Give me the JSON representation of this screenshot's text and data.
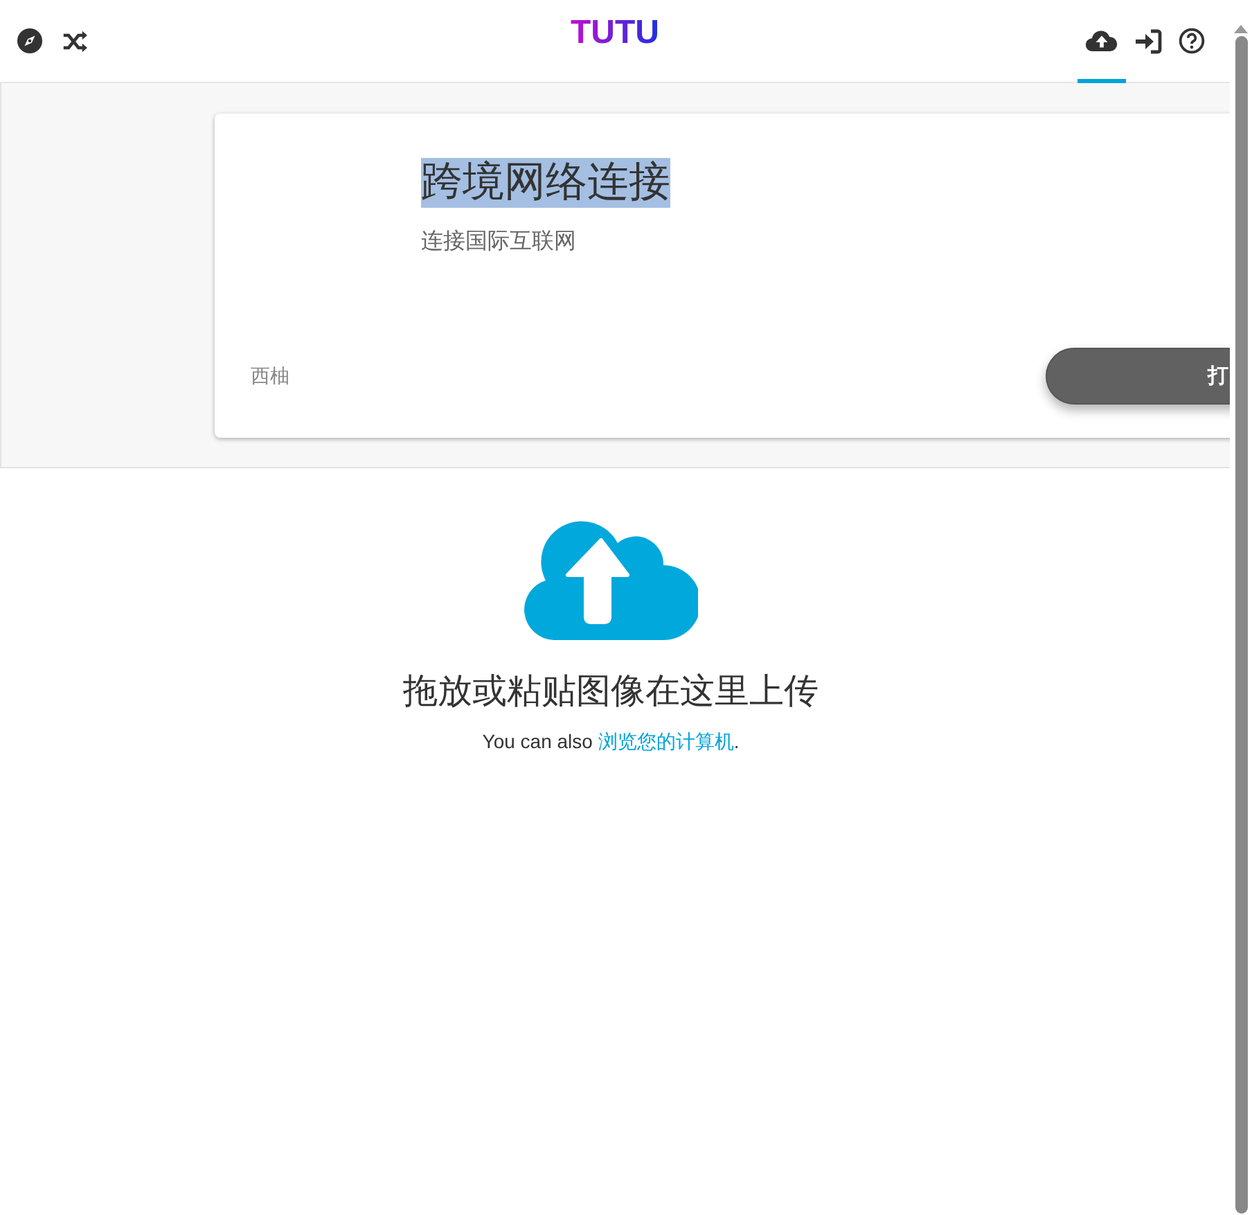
{
  "header": {
    "logo": "TUTU",
    "left_icons": [
      {
        "kind": "compass"
      },
      {
        "kind": "shuffle"
      }
    ],
    "right_icons": [
      {
        "kind": "upload",
        "selected": true
      },
      {
        "kind": "signin",
        "selected": false
      },
      {
        "kind": "help",
        "selected": false
      }
    ]
  },
  "ad": {
    "title": "跨境网络连接",
    "title_highlighted": true,
    "subtitle": "连接国际互联网",
    "source": "西柚",
    "button": "打"
  },
  "upload": {
    "heading": "拖放或粘贴图像在这里上传",
    "prefix": "You can also ",
    "link": "浏览您的计算机",
    "suffix": "."
  }
}
